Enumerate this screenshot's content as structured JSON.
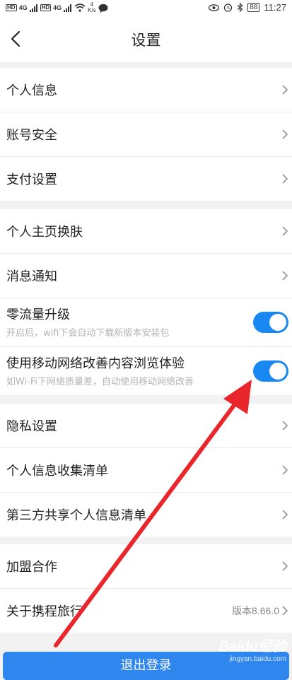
{
  "status_bar": {
    "net1": "4G",
    "net2": "4G",
    "speed_value": "4",
    "speed_unit": "K/s",
    "battery": "88",
    "time": "11:27"
  },
  "header": {
    "title": "设置"
  },
  "groups": [
    {
      "items": [
        {
          "label": "个人信息"
        },
        {
          "label": "账号安全"
        },
        {
          "label": "支付设置"
        }
      ]
    },
    {
      "items": [
        {
          "label": "个人主页换肤"
        },
        {
          "label": "消息通知"
        },
        {
          "label": "零流量升级",
          "description": "开启后，wifi下会自动下载新版本安装包",
          "toggle_on": true
        },
        {
          "label": "使用移动网络改善内容浏览体验",
          "description": "如Wi-Fi下网络质量差，自动使用移动网络改善",
          "toggle_on": true
        }
      ]
    },
    {
      "items": [
        {
          "label": "隐私设置"
        },
        {
          "label": "个人信息收集清单"
        },
        {
          "label": "第三方共享个人信息清单"
        }
      ]
    },
    {
      "items": [
        {
          "label": "加盟合作"
        },
        {
          "label": "关于携程旅行",
          "value": "版本8.66.0"
        }
      ]
    }
  ],
  "bottom_button": {
    "label": "退出登录"
  },
  "watermark": {
    "main": "Baidu经验",
    "sub": "jingyan.baidu.com"
  },
  "colors": {
    "toggle_on": "#1a88f2",
    "annotation_arrow": "#e8262b"
  },
  "icons": [
    "back-arrow-icon",
    "chevron-right-icon",
    "eye-icon",
    "alarm-icon",
    "bluetooth-icon",
    "wifi-icon",
    "message-icon"
  ]
}
